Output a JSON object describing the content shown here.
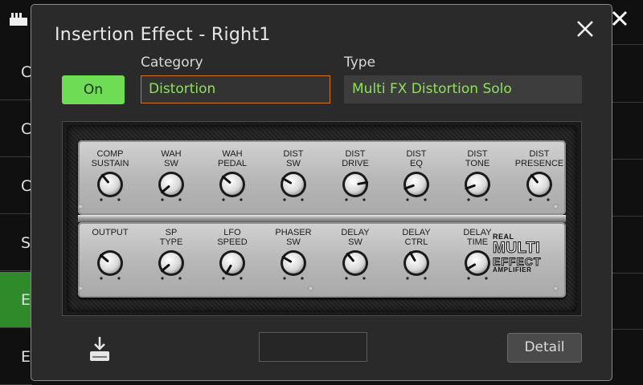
{
  "background": {
    "sidebar_items": [
      {
        "label": "C",
        "active": false
      },
      {
        "label": "C",
        "active": false
      },
      {
        "label": "C",
        "active": false
      },
      {
        "label": "S",
        "active": false
      },
      {
        "label": "E",
        "active": true
      },
      {
        "label": "E",
        "active": false
      }
    ]
  },
  "dialog": {
    "title": "Insertion Effect - Right1",
    "on_button": "On",
    "category_label": "Category",
    "category_value": "Distortion",
    "type_label": "Type",
    "type_value": "Multi FX Distortion Solo",
    "detail_button": "Detail",
    "blank_field": ""
  },
  "amp": {
    "logo": {
      "real": "REAL",
      "multi": "MULTI",
      "effect": "EFFECT",
      "amplifier": "AMPLIFIER"
    },
    "top_row": [
      {
        "label": "COMP\nSUSTAIN",
        "angle": -40
      },
      {
        "label": "WAH\nSW",
        "angle": -130
      },
      {
        "label": "WAH\nPEDAL",
        "angle": -50
      },
      {
        "label": "DIST\nSW",
        "angle": -60
      },
      {
        "label": "DIST\nDRIVE",
        "angle": 80
      },
      {
        "label": "DIST\nEQ",
        "angle": -110
      },
      {
        "label": "DIST\nTONE",
        "angle": -110
      },
      {
        "label": "DIST\nPRESENCE",
        "angle": -40
      }
    ],
    "bottom_row": [
      {
        "label": "OUTPUT",
        "angle": -50
      },
      {
        "label": "SP\nTYPE",
        "angle": -130
      },
      {
        "label": "LFO\nSPEED",
        "angle": -150
      },
      {
        "label": "PHASER\nSW",
        "angle": -60
      },
      {
        "label": "DELAY\nSW",
        "angle": -40
      },
      {
        "label": "DELAY\nCTRL",
        "angle": -30
      },
      {
        "label": "DELAY\nTIME",
        "angle": -120
      }
    ]
  },
  "colors": {
    "accent_green": "#6fdc55",
    "value_green": "#8fe05c",
    "focus_orange": "#d2761e",
    "active_sidebar": "#2f8a2a"
  }
}
